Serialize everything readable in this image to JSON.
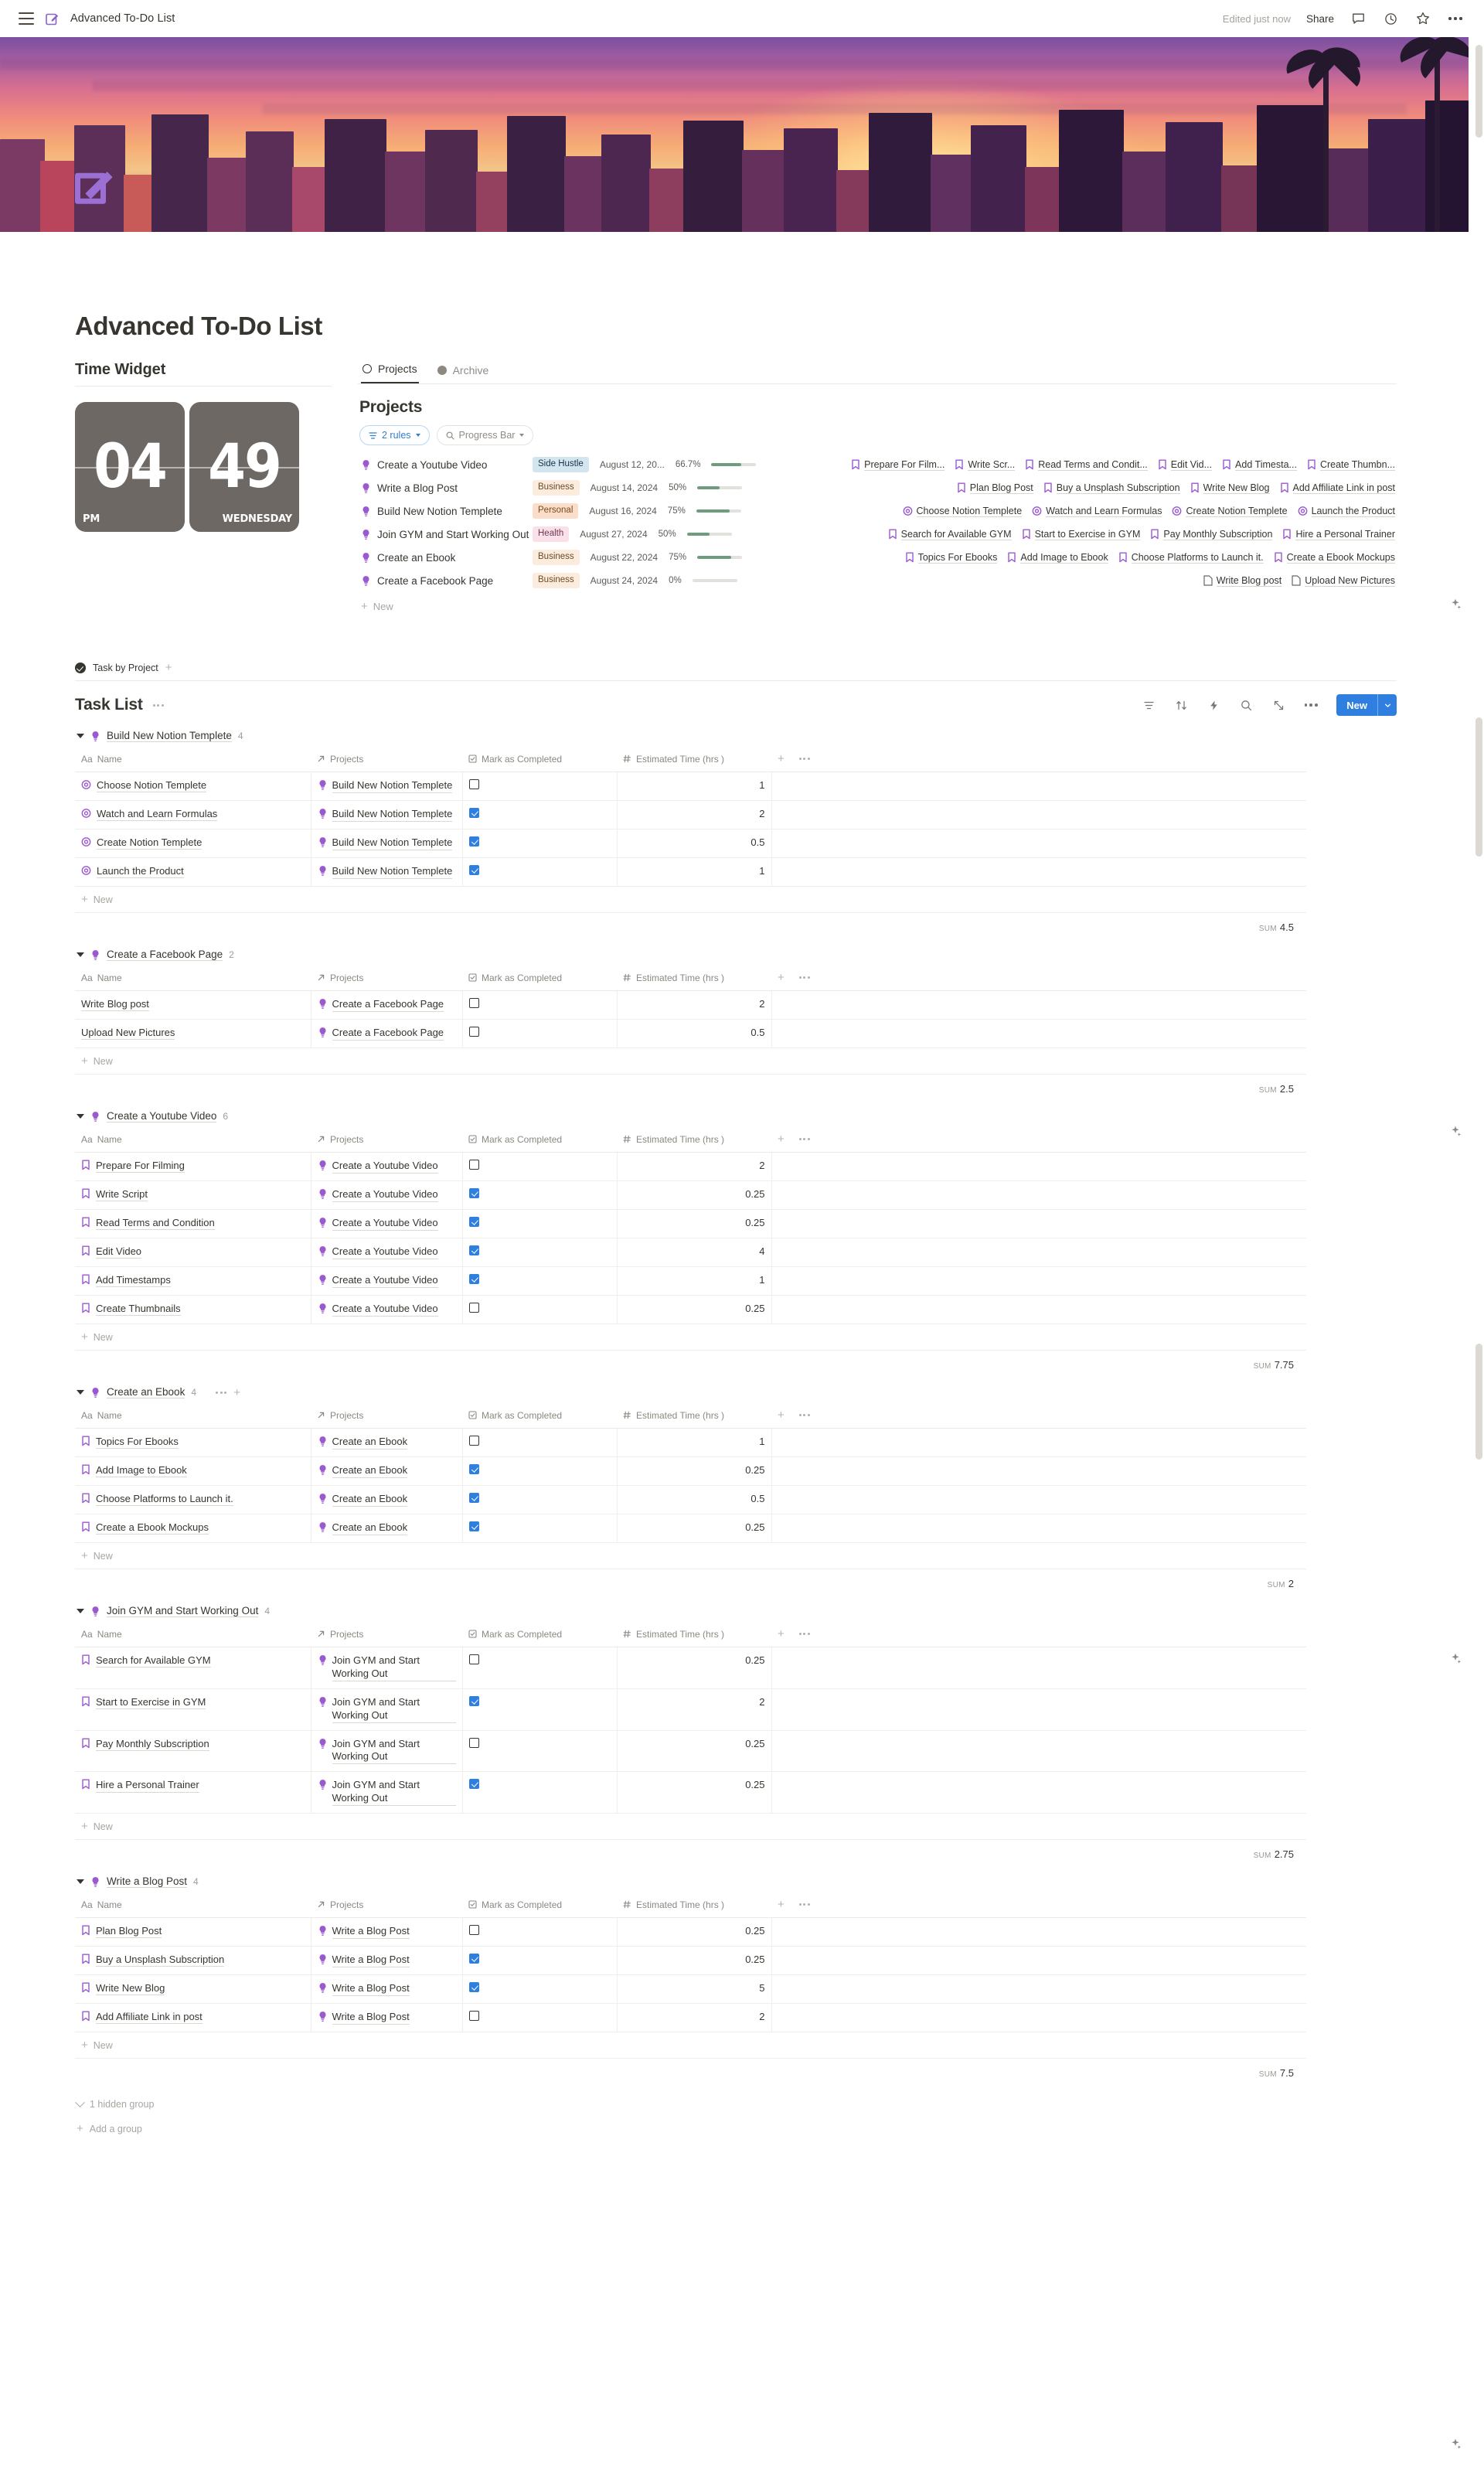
{
  "topbar": {
    "breadcrumb": "Advanced To-Do List",
    "edited": "Edited just now",
    "share": "Share",
    "icons": [
      "menu-icon",
      "document-edit-icon",
      "comment-icon",
      "history-icon",
      "star-icon",
      "more-options-icon"
    ]
  },
  "page": {
    "title": "Advanced To-Do List",
    "icon": "purple-edit-square-icon"
  },
  "time_widget": {
    "heading": "Time Widget",
    "hours": "04",
    "minutes": "49",
    "meridiem": "PM",
    "weekday": "WEDNESDAY"
  },
  "projects_db": {
    "tabs": [
      {
        "label": "Projects",
        "icon": "circle-outline-icon",
        "active": true
      },
      {
        "label": "Archive",
        "icon": "circle-filled-icon",
        "active": false
      }
    ],
    "title": "Projects",
    "filter_pill": "2 rules",
    "search_pill": "Progress Bar",
    "new_label": "New",
    "rows": [
      {
        "name": "Create a Youtube Video",
        "tag": "Side Hustle",
        "tag_class": "side-hustle",
        "date": "August 12, 20...",
        "percent": "66.7%",
        "progress": 66.7,
        "task_icon": "bookmark-icon",
        "tasks": [
          "Prepare For Film...",
          "Write Scr...",
          "Read Terms and Condit...",
          "Edit Vid...",
          "Add Timesta...",
          "Create Thumbn..."
        ]
      },
      {
        "name": "Write a Blog Post",
        "tag": "Business",
        "tag_class": "business",
        "date": "August 14, 2024",
        "percent": "50%",
        "progress": 50,
        "task_icon": "bookmark-icon",
        "tasks": [
          "Plan Blog Post",
          "Buy a Unsplash Subscription",
          "Write New Blog",
          "Add Affiliate Link in post"
        ]
      },
      {
        "name": "Build New Notion Templete",
        "tag": "Personal",
        "tag_class": "personal",
        "date": "August 16, 2024",
        "percent": "75%",
        "progress": 75,
        "task_icon": "target-icon",
        "tasks": [
          "Choose Notion Templete",
          "Watch and Learn Formulas",
          "Create Notion Templete",
          "Launch the Product"
        ]
      },
      {
        "name": "Join GYM and Start Working Out",
        "tag": "Health",
        "tag_class": "health",
        "date": "August 27, 2024",
        "percent": "50%",
        "progress": 50,
        "task_icon": "bookmark-icon",
        "tasks": [
          "Search for Available GYM",
          "Start to Exercise in GYM",
          "Pay Monthly Subscription",
          "Hire a Personal Trainer"
        ]
      },
      {
        "name": "Create an Ebook",
        "tag": "Business",
        "tag_class": "business",
        "date": "August 22, 2024",
        "percent": "75%",
        "progress": 75,
        "task_icon": "bookmark-icon",
        "tasks": [
          "Topics For Ebooks",
          "Add Image to Ebook",
          "Choose Platforms to Launch it.",
          "Create a Ebook Mockups"
        ]
      },
      {
        "name": "Create a Facebook Page",
        "tag": "Business",
        "tag_class": "business",
        "date": "August 24, 2024",
        "percent": "0%",
        "progress": 0,
        "task_icon": "page-icon",
        "tasks": [
          "Write Blog post",
          "Upload New Pictures"
        ]
      }
    ],
    "new_row_label": "New"
  },
  "task_list": {
    "breadcrumb": "Task by Project",
    "title": "Task List",
    "new_button": "New",
    "toolbar_icons": [
      "filter-icon",
      "sort-icon",
      "automation-icon",
      "search-icon",
      "expand-icon",
      "more-options-icon"
    ],
    "columns": [
      {
        "label": "Name",
        "icon": "Aa"
      },
      {
        "label": "Projects",
        "icon": "relation-arrow-icon"
      },
      {
        "label": "Mark as Completed",
        "icon": "checkbox-icon"
      },
      {
        "label": "Estimated Time (hrs )",
        "icon": "number-hash-icon"
      }
    ],
    "add_column": "+",
    "row_new_label": "New",
    "sum_label": "SUM",
    "groups": [
      {
        "name": "Build New Notion Templete",
        "count": "4",
        "has_extra": false,
        "task_icon": "target-icon",
        "sum": "4.5",
        "rows": [
          {
            "name": "Choose Notion Templete",
            "project": "Build New Notion Templete",
            "done": false,
            "hours": "1"
          },
          {
            "name": "Watch and Learn Formulas",
            "project": "Build New Notion Templete",
            "done": true,
            "hours": "2"
          },
          {
            "name": "Create Notion Templete",
            "project": "Build New Notion Templete",
            "done": true,
            "hours": "0.5"
          },
          {
            "name": "Launch the Product",
            "project": "Build New Notion Templete",
            "done": true,
            "hours": "1"
          }
        ]
      },
      {
        "name": "Create a Facebook Page",
        "count": "2",
        "has_extra": false,
        "task_icon": "none",
        "sum": "2.5",
        "rows": [
          {
            "name": "Write Blog post",
            "project": "Create a Facebook Page",
            "done": false,
            "hours": "2"
          },
          {
            "name": "Upload New Pictures",
            "project": "Create a Facebook Page",
            "done": false,
            "hours": "0.5"
          }
        ]
      },
      {
        "name": "Create a Youtube Video",
        "count": "6",
        "has_extra": false,
        "task_icon": "bookmark-icon",
        "sum": "7.75",
        "rows": [
          {
            "name": "Prepare For Filming",
            "project": "Create a Youtube Video",
            "done": false,
            "hours": "2"
          },
          {
            "name": "Write Script",
            "project": "Create a Youtube Video",
            "done": true,
            "hours": "0.25"
          },
          {
            "name": "Read Terms and Condition",
            "project": "Create a Youtube Video",
            "done": true,
            "hours": "0.25"
          },
          {
            "name": "Edit Video",
            "project": "Create a Youtube Video",
            "done": true,
            "hours": "4"
          },
          {
            "name": "Add Timestamps",
            "project": "Create a Youtube Video",
            "done": true,
            "hours": "1"
          },
          {
            "name": "Create Thumbnails",
            "project": "Create a Youtube Video",
            "done": false,
            "hours": "0.25"
          }
        ]
      },
      {
        "name": "Create an Ebook",
        "count": "4",
        "has_extra": true,
        "task_icon": "bookmark-icon",
        "sum": "2",
        "rows": [
          {
            "name": "Topics For Ebooks",
            "project": "Create an Ebook",
            "done": false,
            "hours": "1"
          },
          {
            "name": "Add Image to Ebook",
            "project": "Create an Ebook",
            "done": true,
            "hours": "0.25"
          },
          {
            "name": "Choose Platforms to Launch it.",
            "project": "Create an Ebook",
            "done": true,
            "hours": "0.5"
          },
          {
            "name": "Create a Ebook Mockups",
            "project": "Create an Ebook",
            "done": true,
            "hours": "0.25"
          }
        ]
      },
      {
        "name": "Join GYM and Start Working Out",
        "count": "4",
        "has_extra": false,
        "task_icon": "bookmark-icon",
        "sum": "2.75",
        "rows": [
          {
            "name": "Search for Available GYM",
            "project": "Join GYM and Start Working Out",
            "done": false,
            "hours": "0.25"
          },
          {
            "name": "Start to Exercise in GYM",
            "project": "Join GYM and Start Working Out",
            "done": true,
            "hours": "2"
          },
          {
            "name": "Pay Monthly Subscription",
            "project": "Join GYM and Start Working Out",
            "done": false,
            "hours": "0.25"
          },
          {
            "name": "Hire a Personal Trainer",
            "project": "Join GYM and Start Working Out",
            "done": true,
            "hours": "0.25"
          }
        ]
      },
      {
        "name": "Write a Blog Post",
        "count": "4",
        "has_extra": false,
        "task_icon": "bookmark-icon",
        "sum": "7.5",
        "rows": [
          {
            "name": "Plan Blog Post",
            "project": "Write a Blog Post",
            "done": false,
            "hours": "0.25"
          },
          {
            "name": "Buy a Unsplash Subscription",
            "project": "Write a Blog Post",
            "done": true,
            "hours": "0.25"
          },
          {
            "name": "Write New Blog",
            "project": "Write a Blog Post",
            "done": true,
            "hours": "5"
          },
          {
            "name": "Add Affiliate Link in post",
            "project": "Write a Blog Post",
            "done": false,
            "hours": "2"
          }
        ]
      }
    ],
    "hidden_group": "1 hidden group",
    "add_group": "Add a group"
  },
  "colors": {
    "accent_blue": "#2f7fe0",
    "purple": "#9b59d0",
    "progress_green": "#6f9b7f",
    "text": "#37352f"
  }
}
